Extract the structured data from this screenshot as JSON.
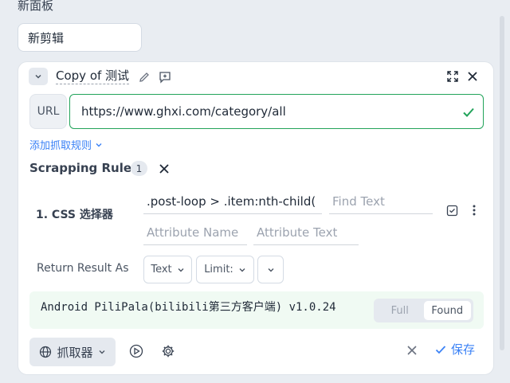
{
  "panel": {
    "title": "新面板",
    "clip_name": "新剪辑"
  },
  "card": {
    "title": "Copy of 测试",
    "url_label": "URL",
    "url_value": "https://www.ghxi.com/category/all",
    "add_rule_label": "添加抓取规则",
    "rules_title": "Scrapping Rules",
    "rules_count": "1",
    "rule": {
      "label": "1. CSS 选择器",
      "selector": ".post-loop > .item:nth-child(",
      "find_text_placeholder": "Find Text",
      "attr_name_placeholder": "Attribute Name",
      "attr_text_placeholder": "Attribute Text"
    },
    "return_label": "Return Result As",
    "return_type": "Text",
    "limit_label": "Limit:",
    "result_text": "Android PiliPala(bilibili第三方客户端) v1.0.24",
    "segment": {
      "full": "Full",
      "found": "Found"
    },
    "extractor_label": "抓取器",
    "save_label": "保存"
  },
  "icons": {
    "collapse": "chevron-down-icon",
    "edit": "pencil-icon",
    "comment": "comment-icon",
    "expand": "expand-icon",
    "close": "close-icon",
    "valid": "check-icon",
    "globe": "globe-icon",
    "play": "play-icon",
    "settings": "gear-icon"
  },
  "colors": {
    "accent": "#3b82f6",
    "success": "#22a35a",
    "result_bg": "#f0faf3"
  }
}
